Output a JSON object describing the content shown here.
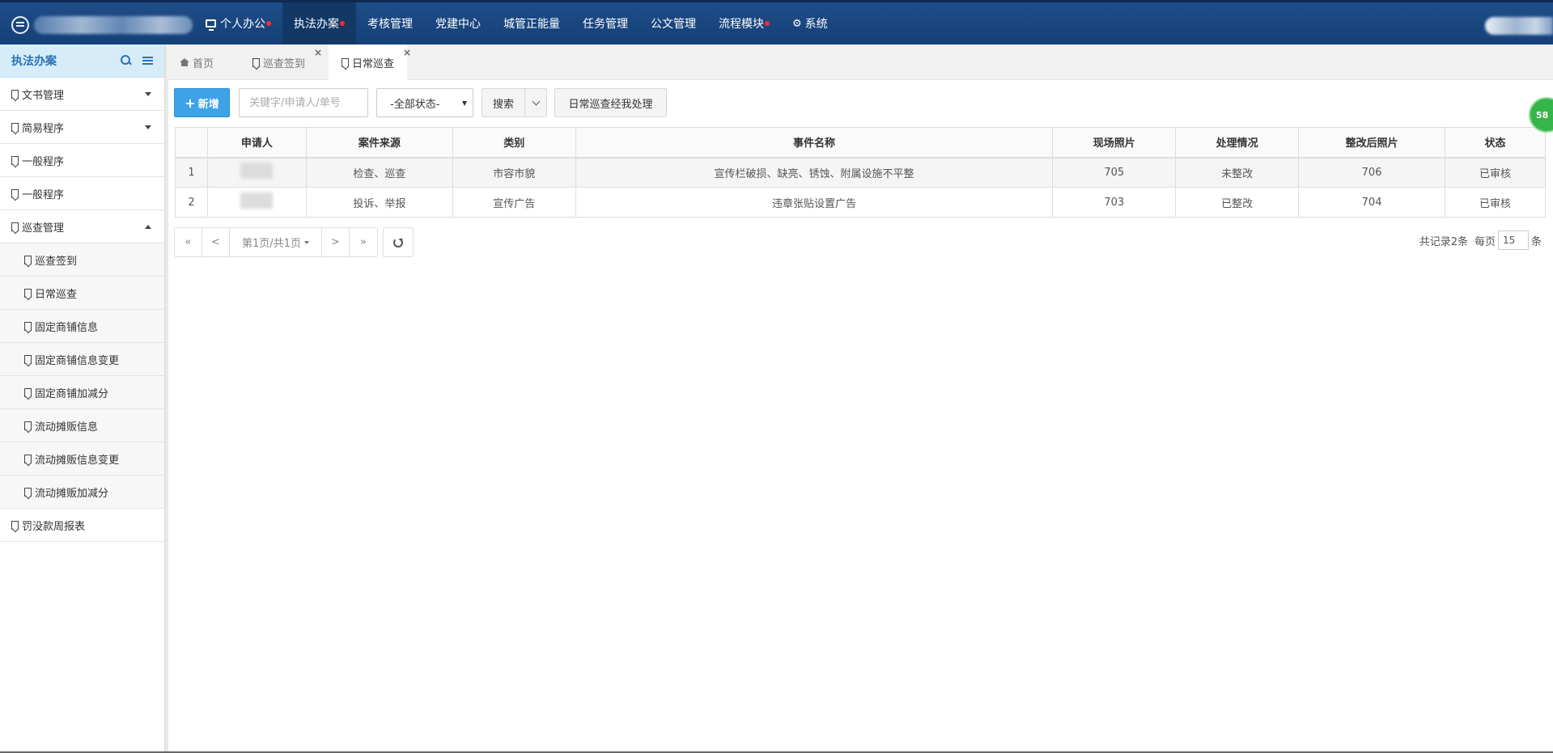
{
  "topnav": {
    "items": [
      {
        "label": "个人办公",
        "dot": true
      },
      {
        "label": "执法办案",
        "dot": true,
        "active": true
      },
      {
        "label": "考核管理"
      },
      {
        "label": "党建中心"
      },
      {
        "label": "城管正能量"
      },
      {
        "label": "任务管理"
      },
      {
        "label": "公文管理"
      },
      {
        "label": "流程模块",
        "dot": true
      },
      {
        "label": "系统"
      }
    ]
  },
  "sidebar": {
    "title": "执法办案",
    "items": [
      {
        "label": "文书管理"
      },
      {
        "label": "简易程序"
      },
      {
        "label": "一般程序"
      },
      {
        "label": "一般程序"
      },
      {
        "label": "巡查管理"
      },
      {
        "label": "巡查签到"
      },
      {
        "label": "日常巡查"
      },
      {
        "label": "固定商铺信息"
      },
      {
        "label": "固定商铺信息变更"
      },
      {
        "label": "固定商铺加减分"
      },
      {
        "label": "流动摊贩信息"
      },
      {
        "label": "流动摊贩信息变更"
      },
      {
        "label": "流动摊贩加减分"
      },
      {
        "label": "罚没款周报表"
      }
    ]
  },
  "tabs": [
    {
      "label": "首页"
    },
    {
      "label": "巡查签到"
    },
    {
      "label": "日常巡查"
    }
  ],
  "toolbar": {
    "add_label": "新增",
    "search_placeholder": "关键字/申请人/单号",
    "status_select": "-全部状态-",
    "search_label": "搜索",
    "handled_label": "日常巡查经我处理"
  },
  "table": {
    "headers": [
      "申请人",
      "案件来源",
      "类别",
      "事件名称",
      "现场照片",
      "处理情况",
      "整改后照片",
      "状态"
    ],
    "rows": [
      {
        "index": "1",
        "source": "检查、巡查",
        "category": "市容市貌",
        "event": "宣传栏破损、缺亮、锈蚀、附属设施不平整",
        "photo": "705",
        "handling": "未整改",
        "after_photo": "706",
        "status": "已审核"
      },
      {
        "index": "2",
        "source": "投诉、举报",
        "category": "宣传广告",
        "event": "违章张贴设置广告",
        "photo": "703",
        "handling": "已整改",
        "after_photo": "704",
        "status": "已审核"
      }
    ]
  },
  "pagination": {
    "first": "«",
    "prev": "<",
    "page_info": "第1页/共1页",
    "next": ">",
    "last": "»",
    "total_text": "共记录2条",
    "per_page_label": "每页",
    "per_page_value": "15",
    "unit": "条"
  },
  "badge": {
    "text": "58"
  },
  "colors": {
    "nav_bg": "#1f4d87",
    "nav_active": "#123866",
    "accent": "#3ea2e6",
    "status_ok": "#2e8b2e",
    "dot": "#ff2a2a"
  }
}
